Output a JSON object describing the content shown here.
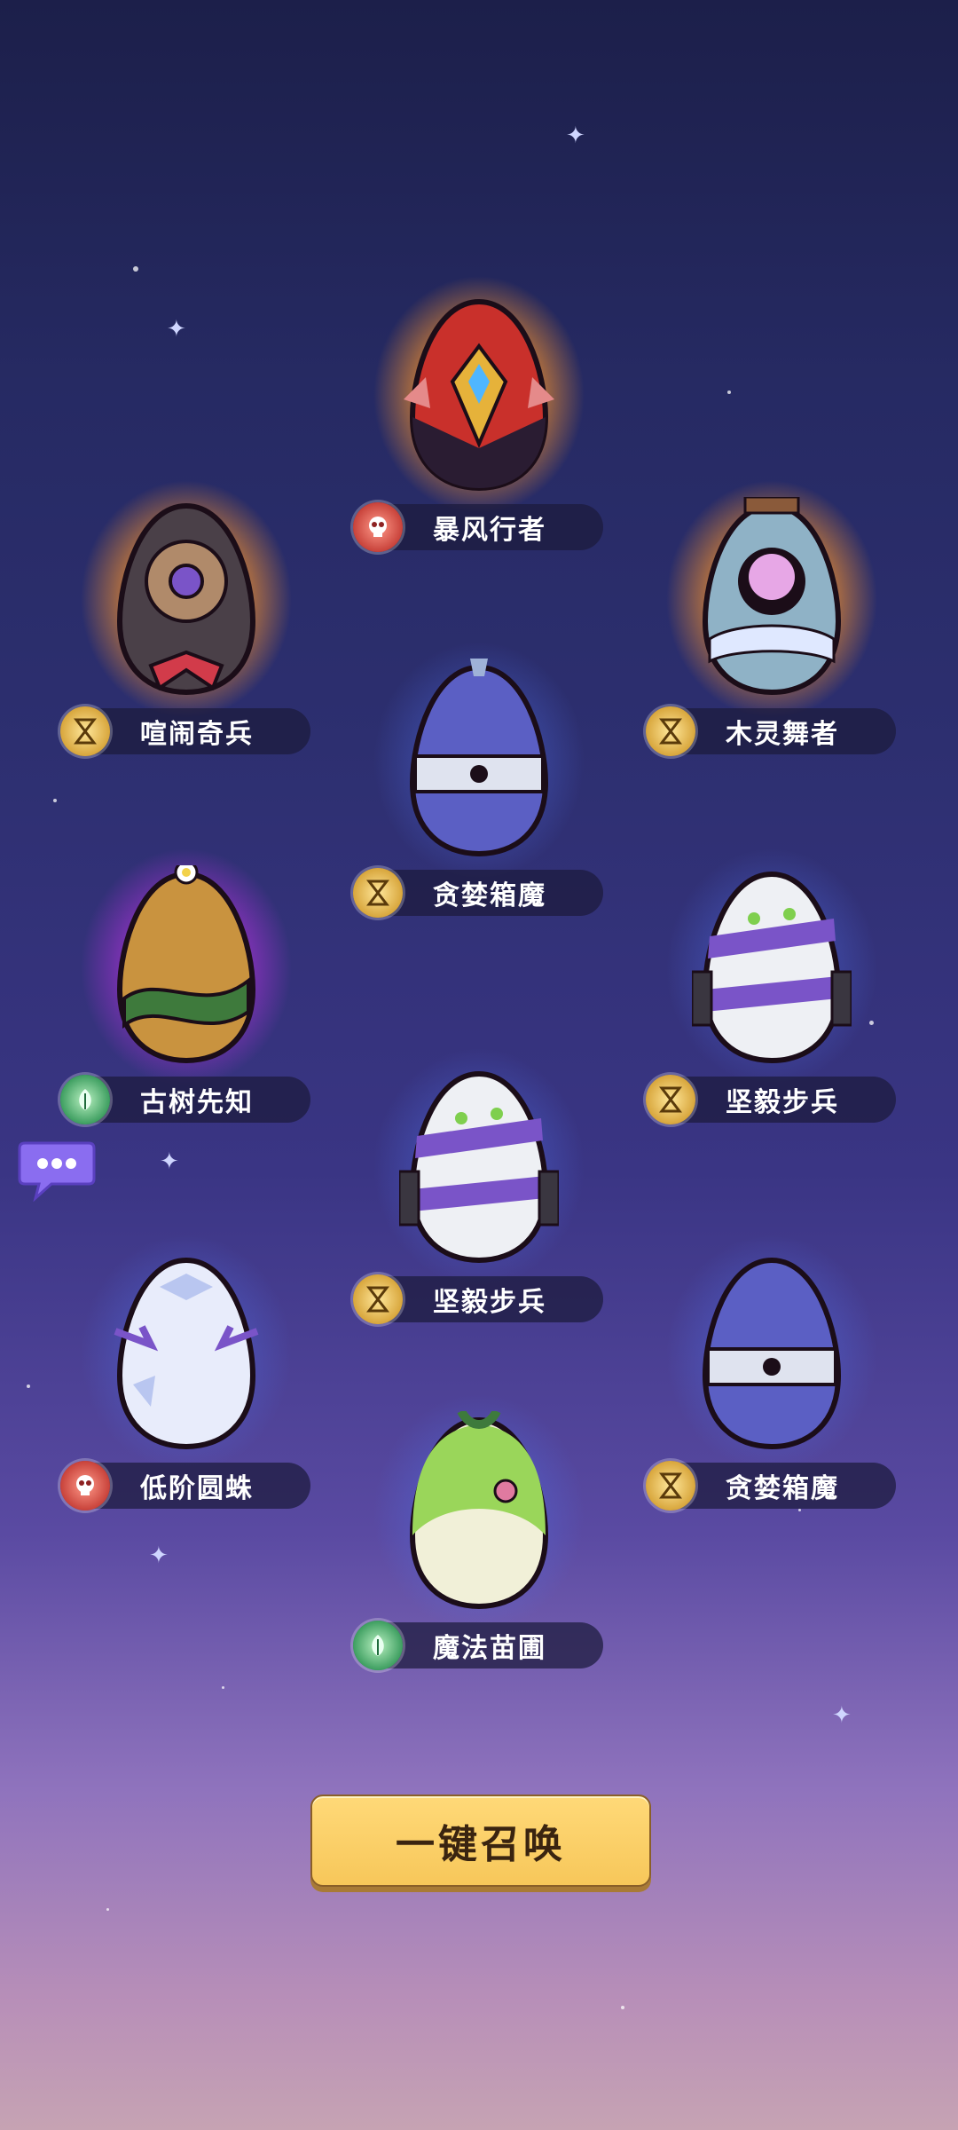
{
  "eggs": [
    {
      "name": "暴风行者",
      "rarity": "legendary",
      "badge": "red-skull-icon",
      "egg_icon": "storm-walker-egg-icon"
    },
    {
      "name": "喧闹奇兵",
      "rarity": "legendary",
      "badge": "gold-hourglass-icon",
      "egg_icon": "noisy-soldier-egg-icon"
    },
    {
      "name": "木灵舞者",
      "rarity": "legendary",
      "badge": "gold-hourglass-icon",
      "egg_icon": "wood-spirit-dancer-egg-icon"
    },
    {
      "name": "贪婪箱魔",
      "rarity": "rare",
      "badge": "gold-hourglass-icon",
      "egg_icon": "greedy-mimic-egg-icon"
    },
    {
      "name": "古树先知",
      "rarity": "epic",
      "badge": "green-leaf-icon",
      "egg_icon": "ancient-tree-prophet-egg-icon"
    },
    {
      "name": "坚毅步兵",
      "rarity": "rare",
      "badge": "gold-hourglass-icon",
      "egg_icon": "steadfast-infantry-egg-icon"
    },
    {
      "name": "坚毅步兵",
      "rarity": "rare",
      "badge": "gold-hourglass-icon",
      "egg_icon": "steadfast-infantry-egg-icon"
    },
    {
      "name": "低阶圆蛛",
      "rarity": "rare",
      "badge": "red-skull-icon",
      "egg_icon": "low-tier-orb-spider-egg-icon"
    },
    {
      "name": "贪婪箱魔",
      "rarity": "rare",
      "badge": "gold-hourglass-icon",
      "egg_icon": "greedy-mimic-egg-icon"
    },
    {
      "name": "魔法苗圃",
      "rarity": "rare",
      "badge": "green-leaf-icon",
      "egg_icon": "magic-nursery-egg-icon"
    }
  ],
  "summon_button": {
    "label": "一键召唤"
  },
  "chat_button": {
    "icon": "chat-bubble-icon"
  },
  "colors": {
    "gold_glow": "#ffb340",
    "purple_glow": "#d24cff",
    "blue_glow": "#6f8cff",
    "button": "#f7c75a"
  }
}
